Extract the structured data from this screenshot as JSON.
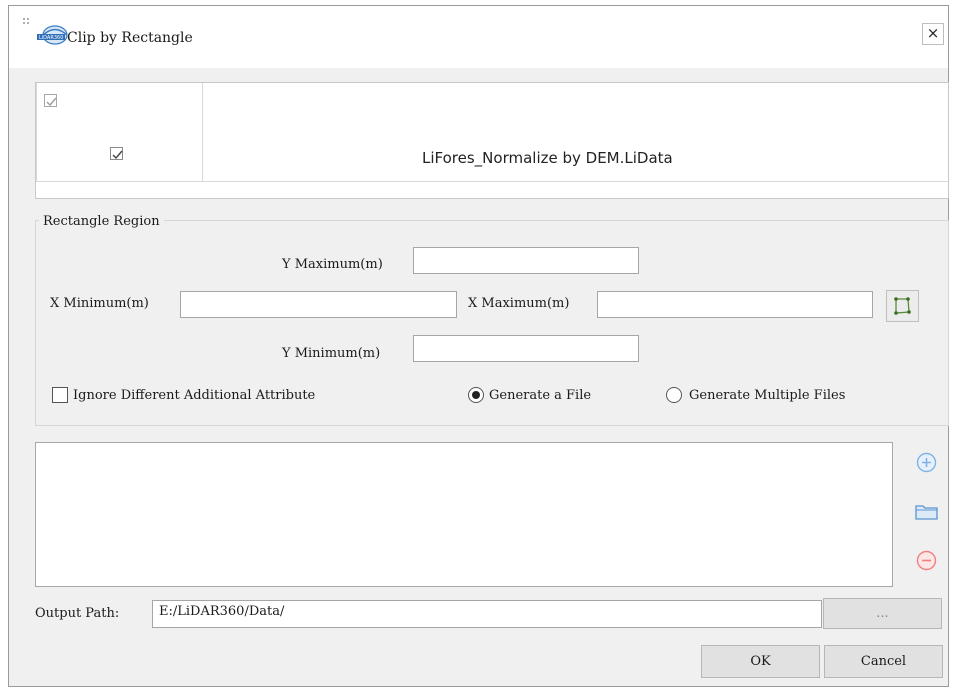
{
  "window": {
    "title": "Clip by Rectangle",
    "close_label": "×",
    "logo_text": "LiDAR360"
  },
  "file_table": {
    "rows": [
      {
        "checked": true,
        "name": "LiFores_Normalize by DEM.LiData"
      }
    ]
  },
  "rect_region": {
    "group_title": "Rectangle Region",
    "ymax_label": "Y Maximum(m)",
    "xmin_label": "X Minimum(m)",
    "xmax_label": "X Maximum(m)",
    "ymin_label": "Y Minimum(m)",
    "ymax_value": "",
    "xmin_value": "",
    "xmax_value": "",
    "ymin_value": ""
  },
  "options": {
    "ignore_attr_label": "Ignore Different Additional Attribute",
    "ignore_attr_checked": false,
    "generate_file_label": "Generate a File",
    "generate_multiple_label": "Generate Multiple Files",
    "selected_mode": "Generate a File"
  },
  "output": {
    "label": "Output Path:",
    "value": "E:/LiDAR360/Data/",
    "browse_label": "..."
  },
  "buttons": {
    "ok": "OK",
    "cancel": "Cancel"
  },
  "colors": {
    "add_icon": "#7fb3e6",
    "folder_icon": "#5b95cf",
    "remove_icon": "#f08080",
    "dialog_bg": "#f0f0f0"
  }
}
